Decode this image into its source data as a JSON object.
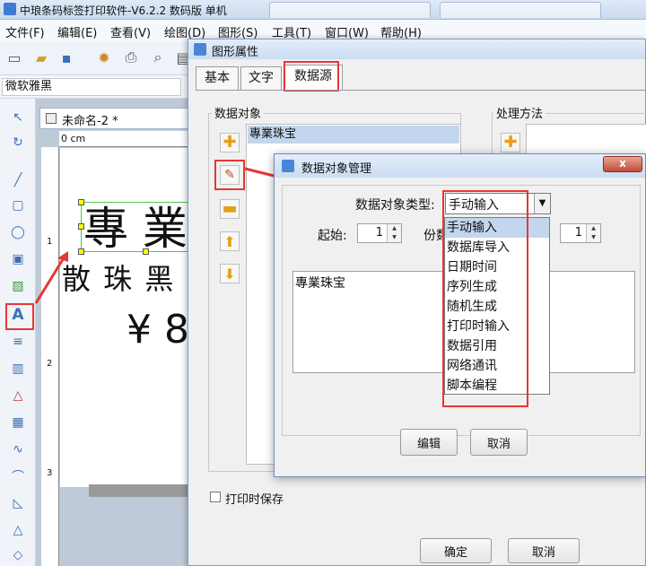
{
  "app": {
    "title": "中琅条码标签打印软件-V6.2.2 数码版 单机"
  },
  "menu": [
    "文件(F)",
    "编辑(E)",
    "查看(V)",
    "绘图(D)",
    "图形(S)",
    "工具(T)",
    "窗口(W)",
    "帮助(H)"
  ],
  "font_selector": {
    "value": "微软雅黑"
  },
  "document": {
    "tab_title": "未命名-2 *",
    "ruler_label": "0 cm",
    "ruler_v_marks": [
      "1",
      "2",
      "3"
    ],
    "canvas_text": {
      "line1": "專 業",
      "line2": "散 珠 黑",
      "line3": "¥ 8"
    }
  },
  "properties_dialog": {
    "title": "图形属性",
    "tabs": [
      "基本",
      "文字",
      "数据源"
    ],
    "active_tab": "数据源",
    "data_objects_label": "数据对象",
    "processing_label": "处理方法",
    "data_items": [
      "專業珠宝"
    ],
    "save_on_print_label": "打印时保存",
    "ok_label": "确定",
    "cancel_label": "取消"
  },
  "data_object_dialog": {
    "title": "数据对象管理",
    "type_label": "数据对象类型:",
    "type_value": "手动输入",
    "start_label": "起始:",
    "start_value": "1",
    "copies_label": "份数",
    "copies_value": "1",
    "text_content": "專業珠宝",
    "edit_label": "编辑",
    "cancel_label": "取消",
    "close_label": "x",
    "type_options": [
      "手动输入",
      "数据库导入",
      "日期时间",
      "序列生成",
      "随机生成",
      "打印时输入",
      "数据引用",
      "网络通讯",
      "脚本编程"
    ],
    "selected_option": "手动输入"
  },
  "colors": {
    "highlight_red": "#e83535",
    "selection_blue": "#c3d6ee"
  }
}
